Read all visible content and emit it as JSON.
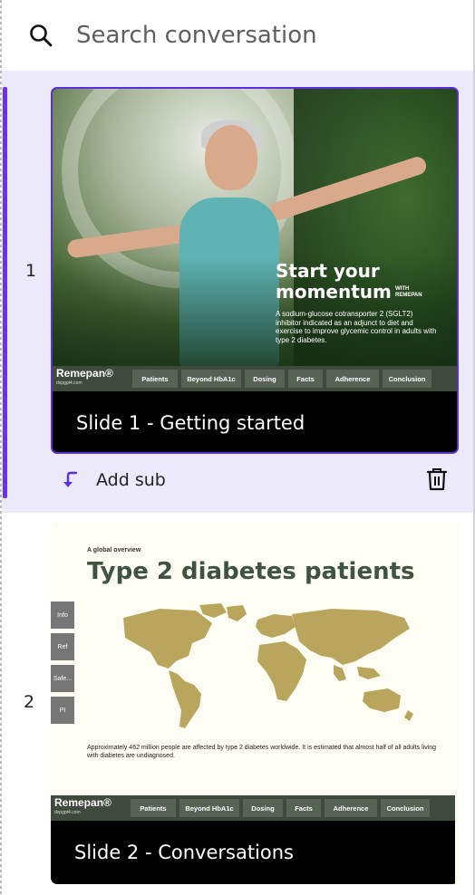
{
  "search": {
    "placeholder": "Search conversation"
  },
  "slides": [
    {
      "index": "1",
      "caption": "Slide 1 - Getting started",
      "headline_line1": "Start your",
      "headline_line2": "momentum",
      "with_brand": "WITH REMEPAN",
      "body": "A sodium-glucose cotransporter 2 (SGLT2) inhibitor indicated as an adjunct to diet and exercise to improve glycemic control in adults with type 2 diabetes."
    },
    {
      "index": "2",
      "caption": "Slide 2 - Conversations",
      "kicker": "A global overview",
      "title": "Type 2 diabetes patients",
      "note": "Approximately 462 million people are affected by type 2 diabetes worldwide. It is estimated that almost half of all adults living with diabetes are undiagnosed.",
      "side_tabs": [
        "Info",
        "Ref",
        "Safe...",
        "PI"
      ]
    }
  ],
  "navbar": {
    "brand": "Remepan®",
    "brand_sub": "dxpgpt4.com",
    "items": [
      "Patients",
      "Beyond HbA1c",
      "Dosing",
      "Facts",
      "Adherence",
      "Conclusion"
    ]
  },
  "actions": {
    "add_sub_label": "Add sub"
  },
  "colors": {
    "accent": "#6a35e8",
    "selected_bg": "#ece9fb",
    "navbar": "#3e4a3b",
    "map": "#b9a55c",
    "title_green": "#3e5440"
  }
}
